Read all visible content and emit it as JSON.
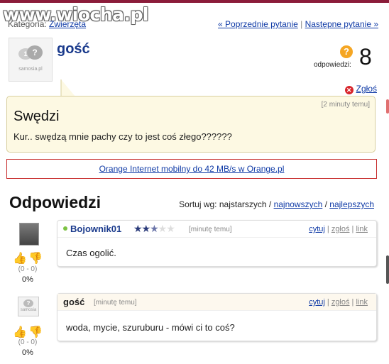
{
  "watermark": "www.wiocha.pl",
  "category": {
    "label": "Kategoria:",
    "value": "Zwierzęta"
  },
  "nav": {
    "prev": "« Poprzednie pytanie",
    "sep": "|",
    "next": "Następne pytanie »"
  },
  "question": {
    "author": "gość",
    "avatar_text": "samosia.pl",
    "answers_count": "8",
    "answers_label": "odpowiedzi:",
    "report": "Zgłoś",
    "time": "[2 minuty temu]",
    "title": "Swędzi",
    "text": "Kur.. swędzą mnie pachy czy to jest coś złego??????"
  },
  "ad": {
    "text": "Orange Internet mobilny do 42 MB/s w Orange.pl"
  },
  "answers_section": {
    "heading": "Odpowiedzi",
    "sort_label": "Sortuj wg: najstarszych /",
    "sort_newest": "najnowszych",
    "sort_sep": "/",
    "sort_best": "najlepszych"
  },
  "answers": [
    {
      "author": "Bojownik01",
      "rating_stars": 2.5,
      "time": "[minutę temu]",
      "text": "Czas ogolić.",
      "votes": "(0 - 0)",
      "percent": "0%",
      "cite": "cytuj",
      "report": "zgłoś",
      "link": "link"
    },
    {
      "author": "gość",
      "avatar_text": "samosia",
      "time": "[minutę temu]",
      "text": "woda, mycie, szuruburu - mówi ci to coś?",
      "votes": "(0 - 0)",
      "percent": "0%",
      "cite": "cytuj",
      "report": "zgłoś",
      "link": "link"
    }
  ],
  "colors": {
    "brand_bar": "#8b1c3a",
    "link": "#0f3aa6",
    "question_bg": "#fdf9e3",
    "ad_border": "#c72c2c"
  },
  "icons": [
    "question-count-icon",
    "report-x-icon",
    "thumb-up-icon",
    "thumb-down-icon",
    "star-rating-icon",
    "online-dot-icon"
  ]
}
